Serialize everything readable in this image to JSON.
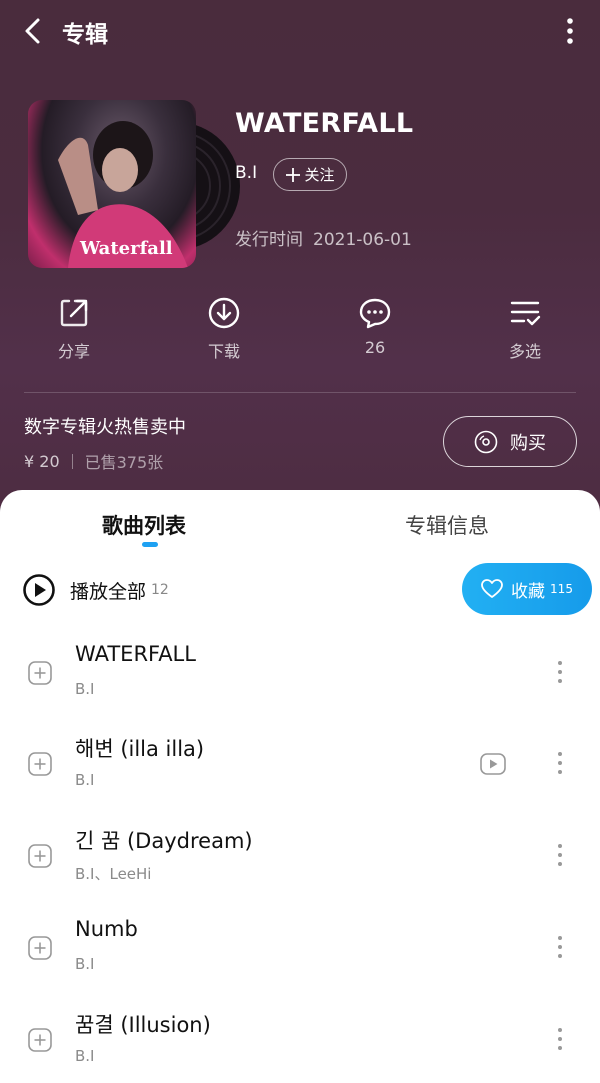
{
  "header": {
    "title": "专辑"
  },
  "album": {
    "title": "WATERFALL",
    "cover_text": "Waterfall",
    "artist": "B.I",
    "follow_label": "关注",
    "release_label": "发行时间",
    "release_date": "2021-06-01"
  },
  "actions": {
    "share": "分享",
    "download": "下载",
    "comments": "26",
    "multi_select": "多选"
  },
  "promo": {
    "text": "数字专辑火热售卖中",
    "price": "¥ 20",
    "sold": "已售375张",
    "buy_label": "购买"
  },
  "tabs": {
    "songs": "歌曲列表",
    "info": "专辑信息"
  },
  "play_all": {
    "label": "播放全部",
    "count": "12"
  },
  "favorite": {
    "label": "收藏",
    "count": "115"
  },
  "songs": [
    {
      "title": "WATERFALL",
      "artist": "B.I",
      "has_mv": false
    },
    {
      "title": "해변 (illa illa)",
      "artist": "B.I",
      "has_mv": true
    },
    {
      "title": "긴 꿈 (Daydream)",
      "artist": "B.I、LeeHi",
      "has_mv": false
    },
    {
      "title": "Numb",
      "artist": "B.I",
      "has_mv": false
    },
    {
      "title": "꿈결 (Illusion)",
      "artist": "B.I",
      "has_mv": false
    }
  ],
  "colors": {
    "hero_bg": "#4b2c3f",
    "accent": "#1ea1f2",
    "favorite_bg": "#169bea"
  }
}
